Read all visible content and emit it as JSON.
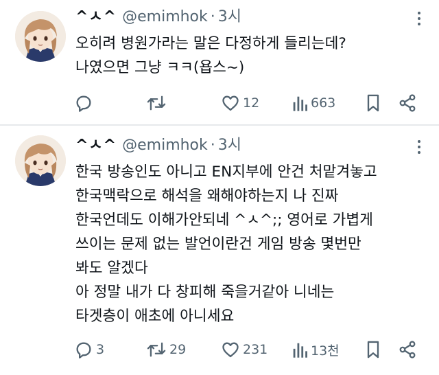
{
  "tweets": [
    {
      "display_name": "^ㅅ^",
      "handle": "@emimhok",
      "dot": "·",
      "time": "3시",
      "lines": [
        "오히려 병원가라는 말은 다정하게 들리는데?",
        "나였으면 그냥 ㅋㅋ(욥스~)"
      ],
      "stats": {
        "replies": "",
        "retweets": "",
        "likes": "12",
        "views": "663"
      }
    },
    {
      "display_name": "^ㅅ^",
      "handle": "@emimhok",
      "dot": "·",
      "time": "3시",
      "lines": [
        "한국 방송인도 아니고 EN지부에 안건 처맡겨놓고",
        "한국맥락으로 해석을 왜해야하는지 나 진짜",
        "한국언데도 이해가안되네 ^ㅅ^;;  영어로 가볍게",
        "쓰이는 문제 없는 발언이란건 게임 방송 몇번만",
        "봐도 알겠다",
        "아 정말 내가 다 창피해 죽을거같아 니네는",
        "타겟층이 애초에 아니세요"
      ],
      "stats": {
        "replies": "3",
        "retweets": "29",
        "likes": "231",
        "views": "13천"
      }
    }
  ],
  "icons": {
    "reply": "reply-bubble-icon",
    "retweet": "retweet-icon",
    "like": "heart-icon",
    "views": "bar-chart-icon",
    "bookmark": "bookmark-icon",
    "share": "share-icon",
    "more": "more-dots-icon"
  },
  "colors": {
    "text": "#0f1419",
    "secondary": "#536471",
    "divider": "#e6e9eb"
  }
}
